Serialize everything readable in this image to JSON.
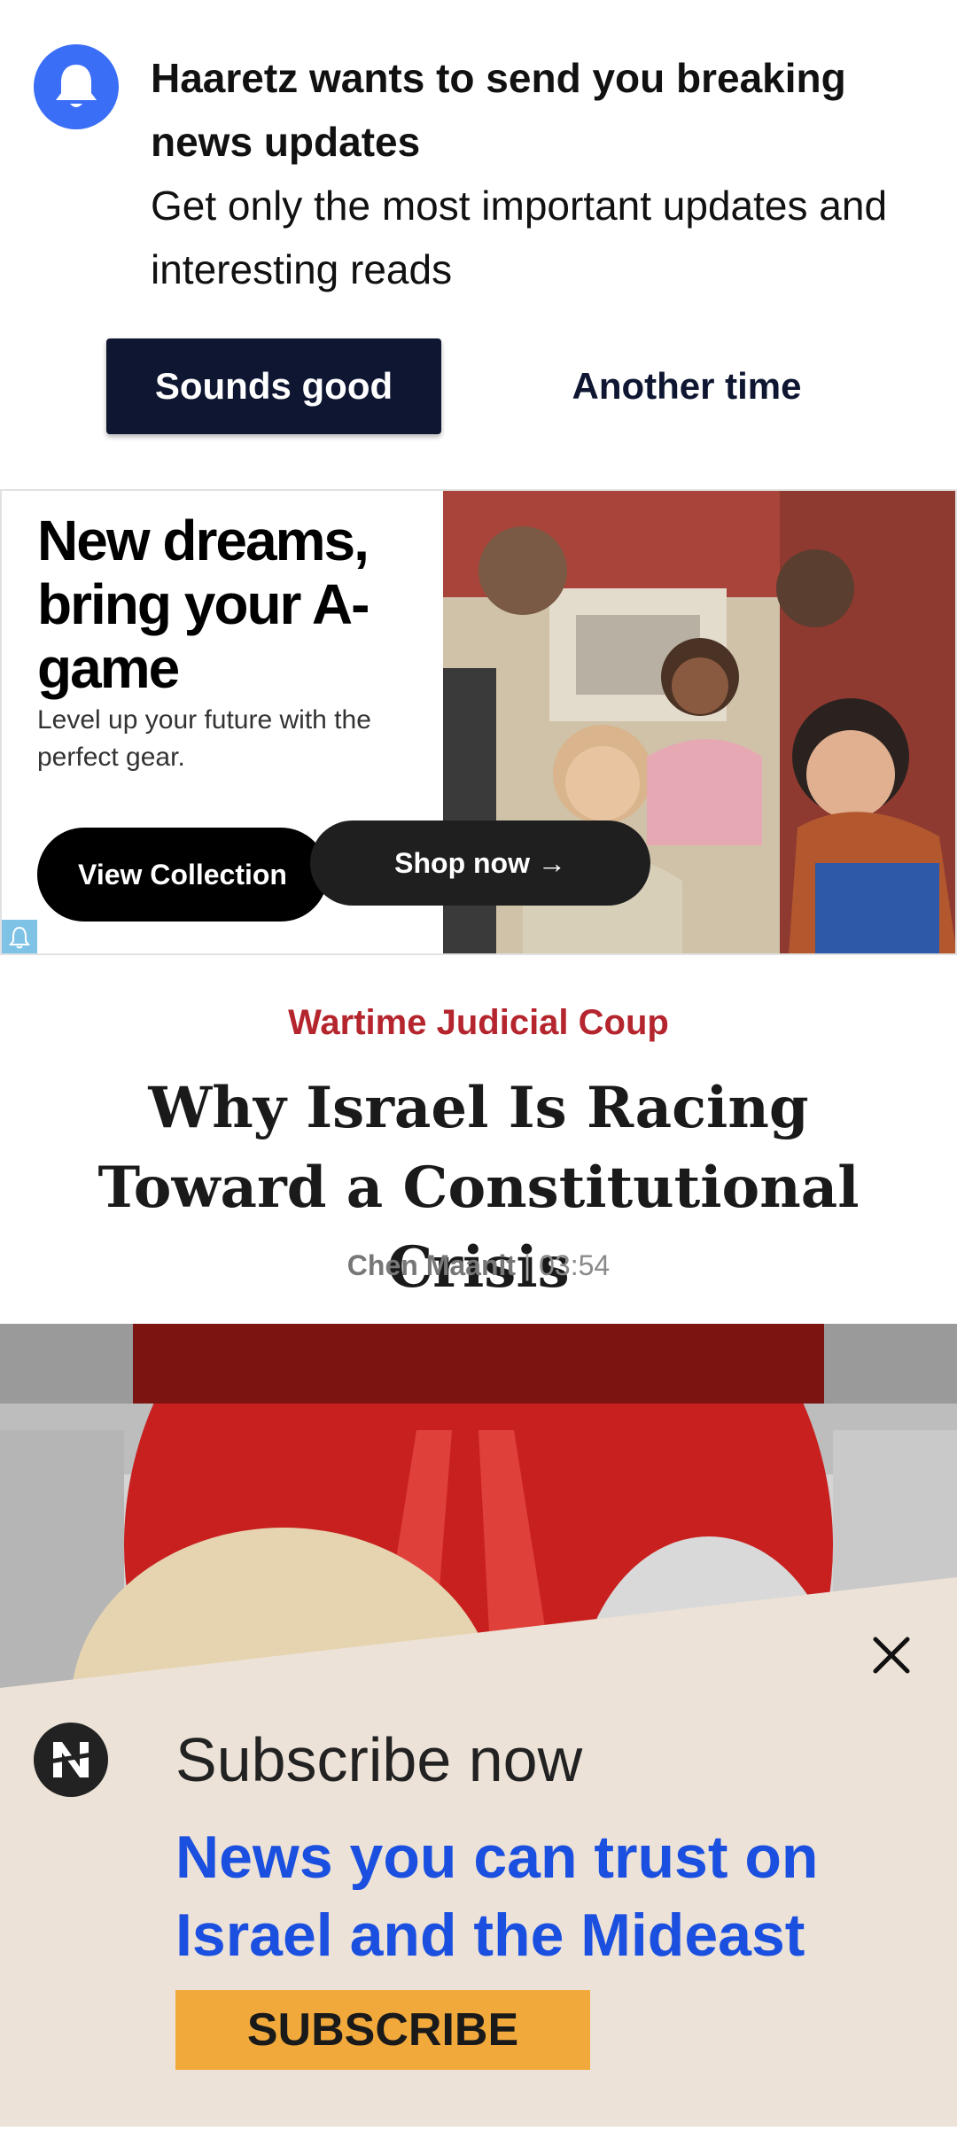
{
  "notification": {
    "icon": "bell-icon",
    "title": "Haaretz wants to send you breaking news updates",
    "subtitle": "Get only the most important updates and interesting reads",
    "accept_label": "Sounds good",
    "decline_label": "Another time",
    "colors": {
      "bell": "#3b6ef6",
      "primary_button": "#0e1631"
    }
  },
  "ad": {
    "headline": "New dreams, bring your A-game",
    "body": "Level up your future with the perfect gear.",
    "view_collection_label": "View Collection",
    "shop_now_label": "Shop now →",
    "adchoices_icon": "ad-info-icon"
  },
  "article": {
    "kicker": "Wartime Judicial Coup",
    "headline": "Why Israel Is Racing Toward a Constitutional Crisis",
    "author": "Chen Maanit",
    "separator": "|",
    "time": "03:54",
    "colors": {
      "kicker": "#b5252e"
    }
  },
  "subscribe": {
    "close_icon": "close-icon",
    "logo_icon": "haaretz-logo-icon",
    "title": "Subscribe now",
    "tagline": "News you can trust on Israel and the Mideast",
    "button_label": "SUBSCRIBE",
    "colors": {
      "background": "#ece2d7",
      "tagline": "#1a4fe0",
      "button": "#f2a93b"
    }
  }
}
